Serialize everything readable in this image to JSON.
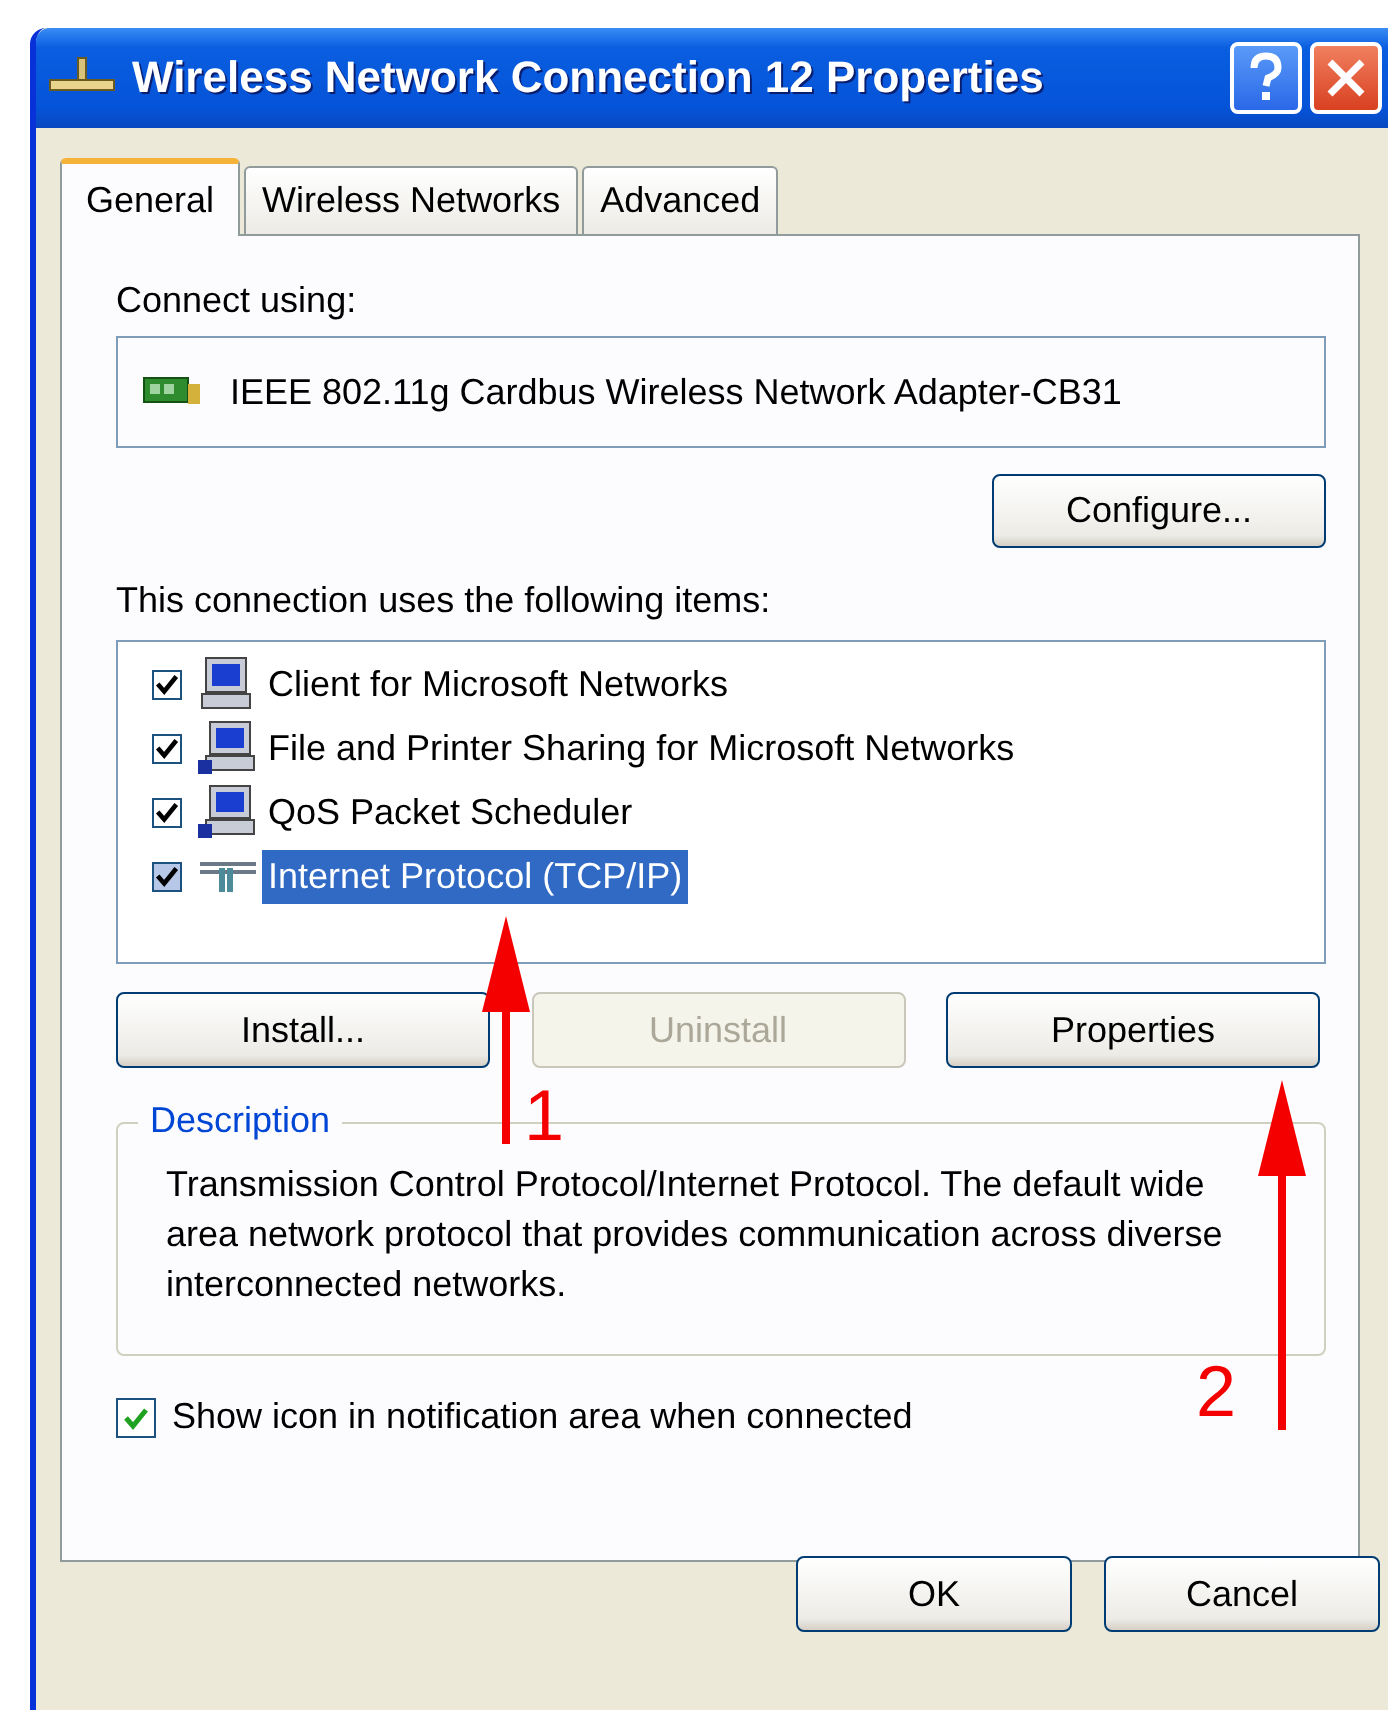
{
  "window": {
    "title": "Wireless Network Connection 12 Properties"
  },
  "tabs": [
    {
      "label": "General",
      "selected": true
    },
    {
      "label": "Wireless Networks",
      "selected": false
    },
    {
      "label": "Advanced",
      "selected": false
    }
  ],
  "connect_using": {
    "label": "Connect using:",
    "adapter": "IEEE 802.11g Cardbus Wireless Network Adapter-CB31",
    "button": "Configure..."
  },
  "items_label": "This connection uses the following items:",
  "items": [
    {
      "label": "Client for Microsoft Networks",
      "kind": "client",
      "checked": true,
      "selected": false
    },
    {
      "label": "File and Printer Sharing for Microsoft Networks",
      "kind": "service",
      "checked": true,
      "selected": false
    },
    {
      "label": "QoS Packet Scheduler",
      "kind": "service",
      "checked": true,
      "selected": false
    },
    {
      "label": "Internet Protocol (TCP/IP)",
      "kind": "protocol",
      "checked": true,
      "selected": true
    }
  ],
  "item_buttons": [
    {
      "label": "Install...",
      "disabled": false
    },
    {
      "label": "Uninstall",
      "disabled": true
    },
    {
      "label": "Properties",
      "disabled": false
    }
  ],
  "description": {
    "title": "Description",
    "text": "Transmission Control Protocol/Internet Protocol. The default wide area network protocol that provides communication across diverse interconnected networks."
  },
  "notification": {
    "label": "Show icon in notification area when connected",
    "checked": true
  },
  "buttons": [
    "OK",
    "Cancel"
  ],
  "annotations": [
    {
      "label": "1"
    },
    {
      "label": "2"
    }
  ]
}
